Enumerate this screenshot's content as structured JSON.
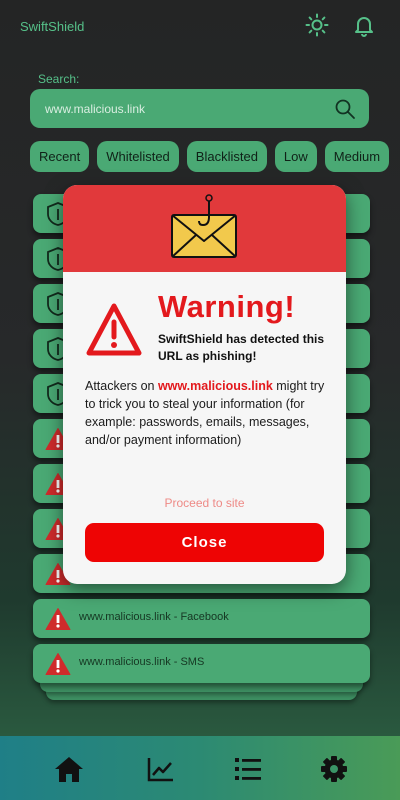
{
  "app": {
    "title": "SwiftShield"
  },
  "header": {
    "icons": [
      "sun-icon",
      "bell-icon"
    ]
  },
  "search": {
    "label": "Search:",
    "value": "www.malicious.link"
  },
  "filters": [
    "Recent",
    "Whitelisted",
    "Blacklisted",
    "Low",
    "Medium"
  ],
  "list": {
    "items": [
      {
        "icon": "shield-icon",
        "label": ""
      },
      {
        "icon": "shield-icon",
        "label": ""
      },
      {
        "icon": "shield-icon",
        "label": ""
      },
      {
        "icon": "shield-icon",
        "label": ""
      },
      {
        "icon": "shield-icon",
        "label": ""
      },
      {
        "icon": "warning-icon",
        "label": ""
      },
      {
        "icon": "warning-icon",
        "label": ""
      },
      {
        "icon": "warning-icon",
        "label": ""
      },
      {
        "icon": "warning-icon",
        "label": ""
      },
      {
        "icon": "warning-icon",
        "label": "www.malicious.link - Facebook"
      },
      {
        "icon": "warning-icon",
        "label": "www.malicious.link - SMS"
      }
    ]
  },
  "modal": {
    "title": "Warning!",
    "subtitle": "SwiftShield has detected this URL as phishing!",
    "body_prefix": "Attackers on ",
    "body_url": "www.malicious.link",
    "body_suffix": " might try to trick you to steal your information (for example: passwords, emails, messages, and/or payment information)",
    "proceed_label": "Proceed to site",
    "close_label": "Close"
  },
  "nav": {
    "icons": [
      "home-icon",
      "chart-icon",
      "list-icon",
      "gear-icon"
    ]
  },
  "colors": {
    "accent": "#4aa974",
    "danger": "#e3191d",
    "header_red": "#e1393b",
    "button_red": "#ee0404"
  }
}
